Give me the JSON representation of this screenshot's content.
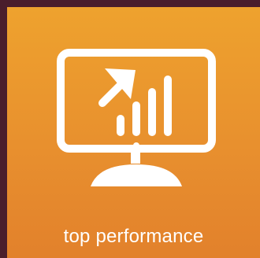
{
  "tile": {
    "caption": "top performance",
    "icon": "monitor-growth-chart-icon",
    "colors": {
      "frame": "#4a1e2c",
      "tile_top": "#eea22e",
      "tile_bottom": "#e2812c",
      "icon": "#ffffff",
      "text": "#ffffff"
    }
  }
}
